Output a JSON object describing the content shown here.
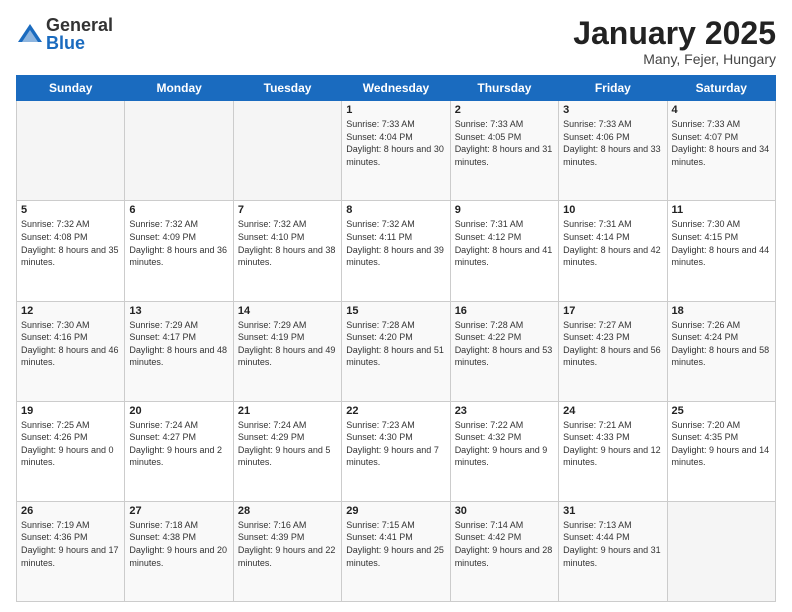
{
  "logo": {
    "general": "General",
    "blue": "Blue"
  },
  "header": {
    "month": "January 2025",
    "location": "Many, Fejer, Hungary"
  },
  "days_of_week": [
    "Sunday",
    "Monday",
    "Tuesday",
    "Wednesday",
    "Thursday",
    "Friday",
    "Saturday"
  ],
  "weeks": [
    [
      {
        "day": "",
        "info": ""
      },
      {
        "day": "",
        "info": ""
      },
      {
        "day": "",
        "info": ""
      },
      {
        "day": "1",
        "info": "Sunrise: 7:33 AM\nSunset: 4:04 PM\nDaylight: 8 hours and 30 minutes."
      },
      {
        "day": "2",
        "info": "Sunrise: 7:33 AM\nSunset: 4:05 PM\nDaylight: 8 hours and 31 minutes."
      },
      {
        "day": "3",
        "info": "Sunrise: 7:33 AM\nSunset: 4:06 PM\nDaylight: 8 hours and 33 minutes."
      },
      {
        "day": "4",
        "info": "Sunrise: 7:33 AM\nSunset: 4:07 PM\nDaylight: 8 hours and 34 minutes."
      }
    ],
    [
      {
        "day": "5",
        "info": "Sunrise: 7:32 AM\nSunset: 4:08 PM\nDaylight: 8 hours and 35 minutes."
      },
      {
        "day": "6",
        "info": "Sunrise: 7:32 AM\nSunset: 4:09 PM\nDaylight: 8 hours and 36 minutes."
      },
      {
        "day": "7",
        "info": "Sunrise: 7:32 AM\nSunset: 4:10 PM\nDaylight: 8 hours and 38 minutes."
      },
      {
        "day": "8",
        "info": "Sunrise: 7:32 AM\nSunset: 4:11 PM\nDaylight: 8 hours and 39 minutes."
      },
      {
        "day": "9",
        "info": "Sunrise: 7:31 AM\nSunset: 4:12 PM\nDaylight: 8 hours and 41 minutes."
      },
      {
        "day": "10",
        "info": "Sunrise: 7:31 AM\nSunset: 4:14 PM\nDaylight: 8 hours and 42 minutes."
      },
      {
        "day": "11",
        "info": "Sunrise: 7:30 AM\nSunset: 4:15 PM\nDaylight: 8 hours and 44 minutes."
      }
    ],
    [
      {
        "day": "12",
        "info": "Sunrise: 7:30 AM\nSunset: 4:16 PM\nDaylight: 8 hours and 46 minutes."
      },
      {
        "day": "13",
        "info": "Sunrise: 7:29 AM\nSunset: 4:17 PM\nDaylight: 8 hours and 48 minutes."
      },
      {
        "day": "14",
        "info": "Sunrise: 7:29 AM\nSunset: 4:19 PM\nDaylight: 8 hours and 49 minutes."
      },
      {
        "day": "15",
        "info": "Sunrise: 7:28 AM\nSunset: 4:20 PM\nDaylight: 8 hours and 51 minutes."
      },
      {
        "day": "16",
        "info": "Sunrise: 7:28 AM\nSunset: 4:22 PM\nDaylight: 8 hours and 53 minutes."
      },
      {
        "day": "17",
        "info": "Sunrise: 7:27 AM\nSunset: 4:23 PM\nDaylight: 8 hours and 56 minutes."
      },
      {
        "day": "18",
        "info": "Sunrise: 7:26 AM\nSunset: 4:24 PM\nDaylight: 8 hours and 58 minutes."
      }
    ],
    [
      {
        "day": "19",
        "info": "Sunrise: 7:25 AM\nSunset: 4:26 PM\nDaylight: 9 hours and 0 minutes."
      },
      {
        "day": "20",
        "info": "Sunrise: 7:24 AM\nSunset: 4:27 PM\nDaylight: 9 hours and 2 minutes."
      },
      {
        "day": "21",
        "info": "Sunrise: 7:24 AM\nSunset: 4:29 PM\nDaylight: 9 hours and 5 minutes."
      },
      {
        "day": "22",
        "info": "Sunrise: 7:23 AM\nSunset: 4:30 PM\nDaylight: 9 hours and 7 minutes."
      },
      {
        "day": "23",
        "info": "Sunrise: 7:22 AM\nSunset: 4:32 PM\nDaylight: 9 hours and 9 minutes."
      },
      {
        "day": "24",
        "info": "Sunrise: 7:21 AM\nSunset: 4:33 PM\nDaylight: 9 hours and 12 minutes."
      },
      {
        "day": "25",
        "info": "Sunrise: 7:20 AM\nSunset: 4:35 PM\nDaylight: 9 hours and 14 minutes."
      }
    ],
    [
      {
        "day": "26",
        "info": "Sunrise: 7:19 AM\nSunset: 4:36 PM\nDaylight: 9 hours and 17 minutes."
      },
      {
        "day": "27",
        "info": "Sunrise: 7:18 AM\nSunset: 4:38 PM\nDaylight: 9 hours and 20 minutes."
      },
      {
        "day": "28",
        "info": "Sunrise: 7:16 AM\nSunset: 4:39 PM\nDaylight: 9 hours and 22 minutes."
      },
      {
        "day": "29",
        "info": "Sunrise: 7:15 AM\nSunset: 4:41 PM\nDaylight: 9 hours and 25 minutes."
      },
      {
        "day": "30",
        "info": "Sunrise: 7:14 AM\nSunset: 4:42 PM\nDaylight: 9 hours and 28 minutes."
      },
      {
        "day": "31",
        "info": "Sunrise: 7:13 AM\nSunset: 4:44 PM\nDaylight: 9 hours and 31 minutes."
      },
      {
        "day": "",
        "info": ""
      }
    ]
  ]
}
